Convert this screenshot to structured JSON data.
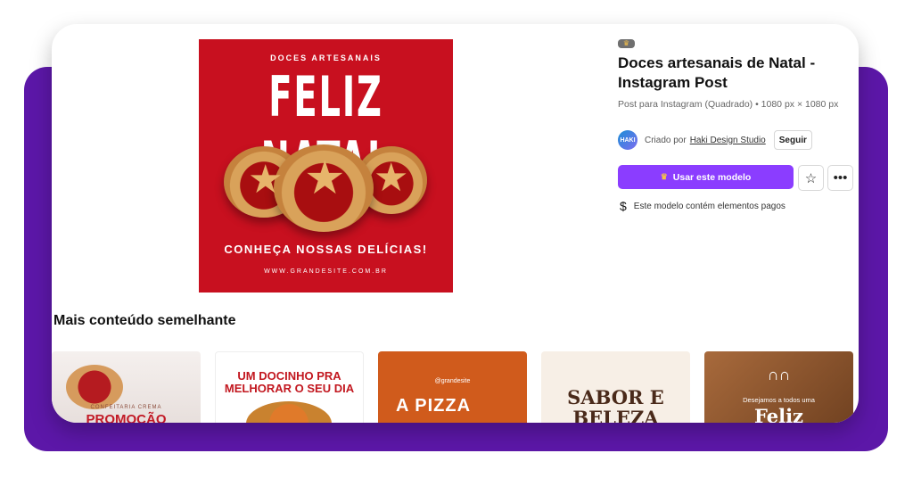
{
  "preview": {
    "top_text": "DOCES ARTESANAIS",
    "big_title": "FELIZ NATAL",
    "subtitle": "CONHEÇA NOSSAS DELÍCIAS!",
    "url": "WWW.GRANDESITE.COM.BR"
  },
  "info": {
    "badge_icon": "crown-icon",
    "title": "Doces artesanais de Natal - Instagram Post",
    "subtitle": "Post para Instagram (Quadrado) • 1080 px × 1080 px",
    "avatar_text": "HAKI",
    "created_by": "Criado por",
    "creator_name": "Haki Design Studio",
    "follow": "Seguir",
    "use_button": "Usar este modelo",
    "star_icon": "star-icon",
    "more_icon": "more-icon",
    "paid_text": "Este modelo contém elementos pagos"
  },
  "similar": {
    "title": "Mais conteúdo semelhante",
    "items": [
      {
        "small": "CONFEITARIA CREMA",
        "big": "PROMOÇÃO"
      },
      {
        "text": "UM DOCINHO PRA MELHORAR O SEU DIA"
      },
      {
        "handle": "@grandesite",
        "big": "A PIZZA"
      },
      {
        "text": "SABOR E BELEZA"
      },
      {
        "small": "Desejamos a todos uma",
        "big": "Feliz"
      }
    ]
  },
  "colors": {
    "accent": "#8b3dff",
    "outer": "#5c17a8",
    "preview_bg": "#c8101f"
  }
}
